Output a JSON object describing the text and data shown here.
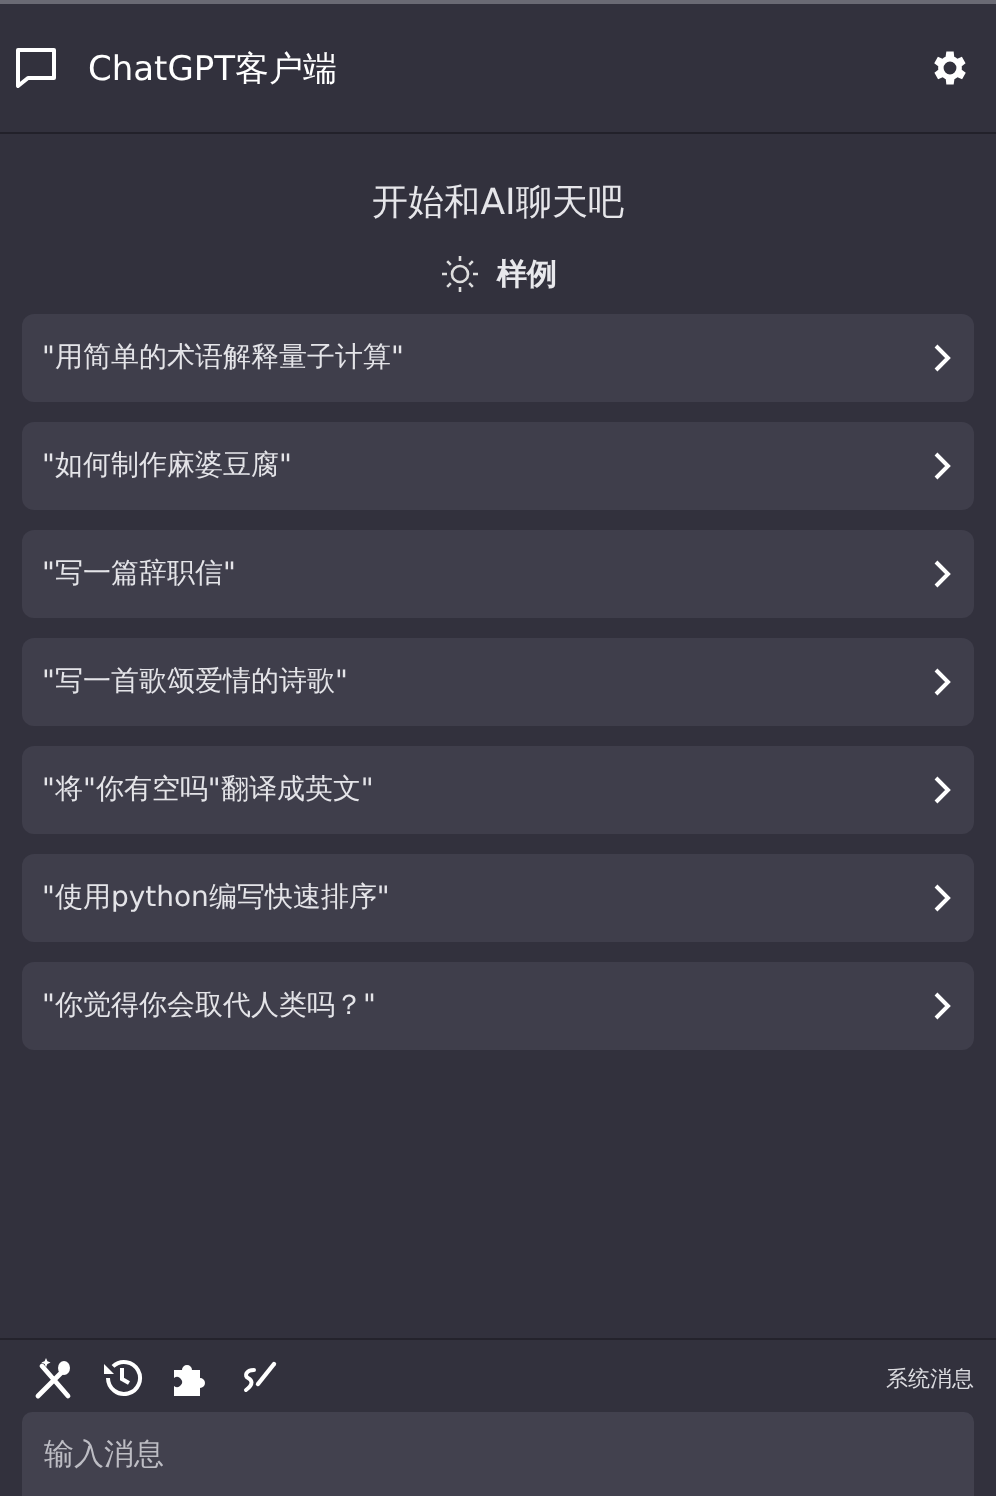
{
  "header": {
    "title": "ChatGPT客户端"
  },
  "welcome": {
    "title": "开始和AI聊天吧",
    "examples_label": "样例"
  },
  "examples": [
    "\"用简单的术语解释量子计算\"",
    "\"如何制作麻婆豆腐\"",
    "\"写一篇辞职信\"",
    "\"写一首歌颂爱情的诗歌\"",
    "\"将\"你有空吗\"翻译成英文\"",
    "\"使用python编写快速排序\"",
    "\"你觉得你会取代人类吗？\""
  ],
  "toolbar": {
    "system_message": "系统消息"
  },
  "input": {
    "placeholder": "输入消息"
  }
}
